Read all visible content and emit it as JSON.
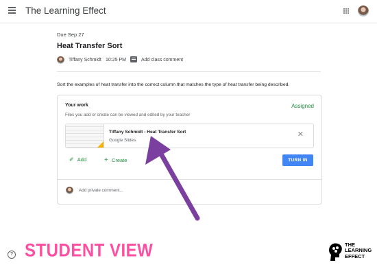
{
  "header": {
    "app_title": "The Learning Effect",
    "menu_icon": "hamburger-menu-icon",
    "apps_icon": "apps-grid-icon"
  },
  "assignment": {
    "due": "Due Sep 27",
    "title": "Heat Transfer Sort",
    "author": "Tiffany Schmidt",
    "time": "10:25 PM",
    "add_class_comment": "Add class comment",
    "instructions": "Sort the examples of heat transfer into the correct column that matches the type of heat transfer being described."
  },
  "your_work": {
    "title": "Your work",
    "status": "Assigned",
    "subtitle": "Files you add or create can be viewed and edited by your teacher",
    "attachment": {
      "title": "Tiffany Schmidt - Heat Transfer Sort",
      "type": "Google Slides"
    },
    "add_label": "Add",
    "create_label": "Create",
    "turn_in_label": "TURN IN",
    "private_comment_placeholder": "Add private comment..."
  },
  "overlay": {
    "caption": "STUDENT VIEW",
    "logo_line1": "THE",
    "logo_line2": "LEARNING",
    "logo_line3": "EFFECT",
    "arrow_color": "#7b3fa0",
    "caption_color": "#ff4fa3"
  },
  "help_label": "?"
}
